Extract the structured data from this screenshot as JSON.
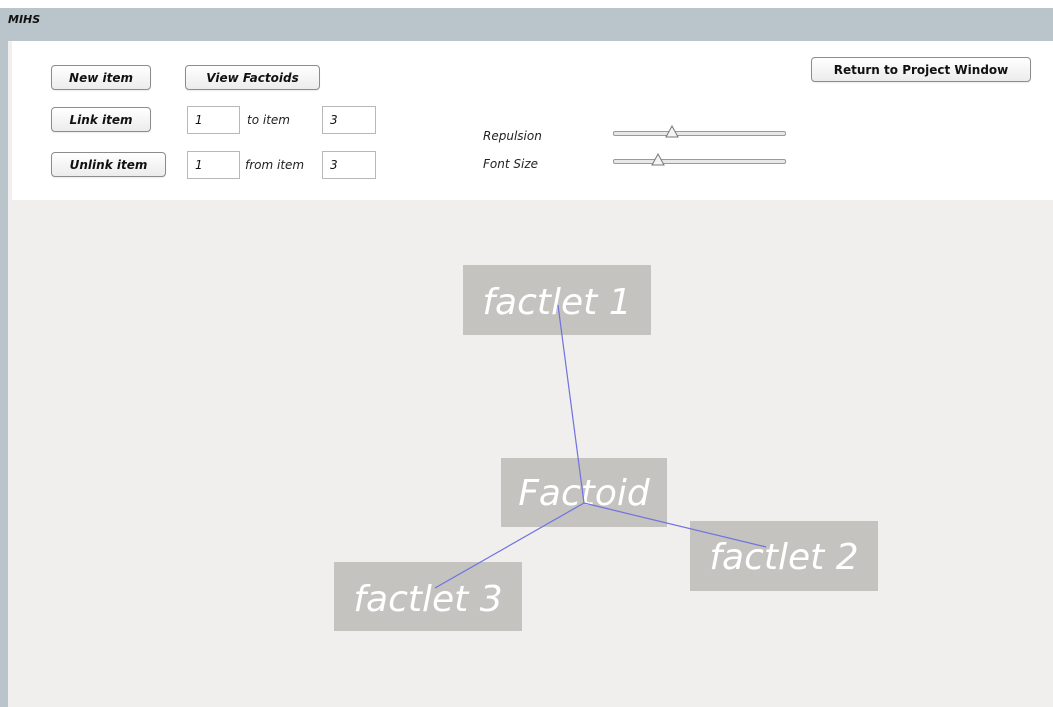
{
  "app": {
    "title": "MIHS"
  },
  "toolbar": {
    "new_item": "New item",
    "view_factoids": "View Factoids",
    "link_item": "Link item",
    "link_from": "1",
    "link_to_label": "to item",
    "link_to": "3",
    "unlink_item": "Unlink item",
    "unlink_from": "1",
    "unlink_from_label": "from item",
    "unlink_to": "3",
    "return_button": "Return to Project Window"
  },
  "sliders": [
    {
      "label": "Repulsion",
      "level": 0.33
    },
    {
      "label": "Font Size",
      "level": 0.24
    }
  ],
  "graph": {
    "edge_color": "#6f72e0",
    "node_color": "#c4c3c0",
    "nodes": [
      {
        "id": "factoid",
        "label": "Factoid"
      },
      {
        "id": "factlet1",
        "label": "factlet 1"
      },
      {
        "id": "factlet2",
        "label": "factlet 2"
      },
      {
        "id": "factlet3",
        "label": "factlet 3"
      }
    ],
    "edges": [
      [
        "factoid",
        "factlet1"
      ],
      [
        "factoid",
        "factlet2"
      ],
      [
        "factoid",
        "factlet3"
      ]
    ]
  }
}
